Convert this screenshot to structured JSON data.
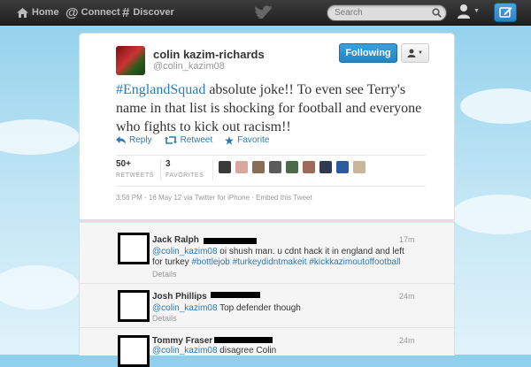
{
  "nav": {
    "home": "Home",
    "connect": "Connect",
    "discover": "Discover",
    "search_placeholder": "Search"
  },
  "tweet": {
    "fullname": "colin kazim-richards",
    "screenname": "@colin_kazim08",
    "follow_label": "Following",
    "text_hashtag": "#EnglandSquad",
    "text_body": " absolute joke!! To even see Terry's name in that list is shocking for football and everyone who fights to kick out racism!!",
    "actions": {
      "reply": "Reply",
      "retweet": "Retweet",
      "favorite": "Favorite"
    },
    "retweets": "50+",
    "retweets_label": "RETWEETS",
    "favorites": "3",
    "favorites_label": "FAVORITES",
    "timestamp": "3:56 PM - 16 May 12 via Twitter for iPhone · Embed this Tweet"
  },
  "replies": [
    {
      "name": "Jack Ralph",
      "time": "17m",
      "mention": "@colin_kazim08",
      "text": " oi shush man. u cdnt hack it in england and left for turkey ",
      "hashtags": "#bottlejob #turkeydidntmakeit #kickkazimoutoffootball",
      "details": "Details"
    },
    {
      "name": "Josh Phillips",
      "time": "24m",
      "mention": "@colin_kazim08",
      "text": " Top defender though",
      "details": "Details"
    },
    {
      "name": "Tommy Fraser",
      "time": "24m",
      "mention": "@colin_kazim08",
      "text": " disagree Colin"
    }
  ],
  "colors": {
    "link": "#2a7ab8",
    "follow_button": "#2485c4",
    "topbar": "#2b2b2b"
  }
}
